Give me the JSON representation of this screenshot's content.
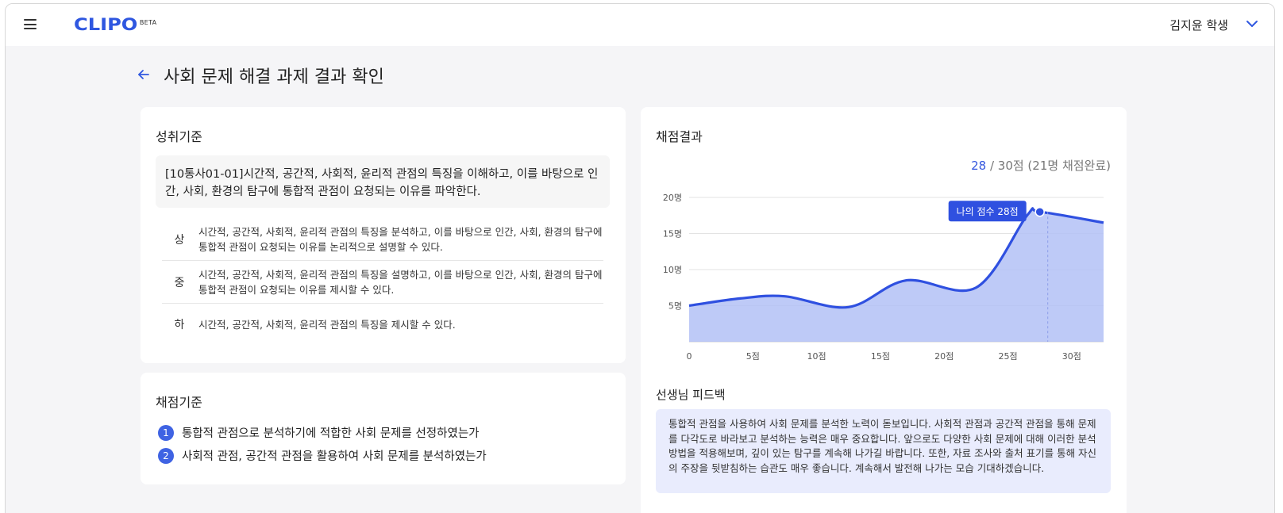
{
  "header": {
    "logo": "CLIPO",
    "logo_badge": "BETA",
    "user_name": "김지윤 학생"
  },
  "page": {
    "title": "사회 문제 해결 과제 결과 확인"
  },
  "achievement": {
    "title": "성취기준",
    "standard": "[10통사01-01]시간적, 공간적, 사회적, 윤리적 관점의 특징을 이해하고, 이를 바탕으로 인간, 사회, 환경의 탐구에 통합적 관점이 요청되는 이유를 파악한다.",
    "levels": [
      {
        "label": "상",
        "text": "시간적, 공간적, 사회적, 윤리적 관점의 특징을 분석하고, 이를 바탕으로 인간, 사회, 환경의 탐구에 통합적 관점이 요청되는 이유를 논리적으로 설명할 수 있다."
      },
      {
        "label": "중",
        "text": "시간적, 공간적, 사회적, 윤리적 관점의 특징을 설명하고, 이를 바탕으로 인간, 사회, 환경의 탐구에 통합적 관점이 요청되는 이유를 제시할 수 있다."
      },
      {
        "label": "하",
        "text": "시간적, 공간적, 사회적, 윤리적 관점의 특징을 제시할 수 있다."
      }
    ]
  },
  "criteria": {
    "title": "채점기준",
    "items": [
      {
        "num": "1",
        "text": "통합적 관점으로 분석하기에 적합한 사회 문제를 선정하였는가"
      },
      {
        "num": "2",
        "text": "사회적 관점, 공간적 관점을 활용하여 사회 문제를 분석하였는가"
      }
    ]
  },
  "result": {
    "title": "채점결과",
    "my_score": "28",
    "score_rest": " / 30점 (21명 채점완료)",
    "tooltip": "나의 점수 28점"
  },
  "chart_data": {
    "type": "area",
    "title": "",
    "xlabel": "",
    "ylabel": "",
    "x_ticks": [
      "0",
      "5점",
      "10점",
      "15점",
      "20점",
      "25점",
      "30점"
    ],
    "y_ticks": [
      "5명",
      "10명",
      "15명",
      "20명"
    ],
    "xlim": [
      0,
      32.5
    ],
    "ylim": [
      0,
      20
    ],
    "x": [
      0,
      4,
      7.5,
      12.5,
      17,
      22.5,
      26.5,
      27.5,
      32.5
    ],
    "y": [
      5,
      6,
      6.3,
      4.8,
      8.5,
      7.5,
      17.5,
      18,
      16.5
    ],
    "highlight": {
      "x": 27.5,
      "y": 18,
      "label": "나의 점수 28점"
    },
    "colors": {
      "line": "#2f50e0",
      "fill": "#b3c1f6",
      "highlight": "#2f50e0"
    }
  },
  "feedback": {
    "title": "선생님 피드백",
    "text": "통합적 관점을 사용하여 사회 문제를 분석한 노력이 돋보입니다. 사회적 관점과 공간적 관점을 통해 문제를 다각도로 바라보고 분석하는 능력은 매우 중요합니다. 앞으로도 다양한 사회 문제에 대해 이러한 분석 방법을 적용해보며, 깊이 있는 탐구를 계속해 나가길 바랍니다. 또한, 자료 조사와 출처 표기를 통해 자신의 주장을 뒷받침하는 습관도 매우 좋습니다. 계속해서 발전해 나가는 모습 기대하겠습니다."
  },
  "colors": {
    "accent": "#2f57e0",
    "page_bg": "#f5f5f7"
  }
}
